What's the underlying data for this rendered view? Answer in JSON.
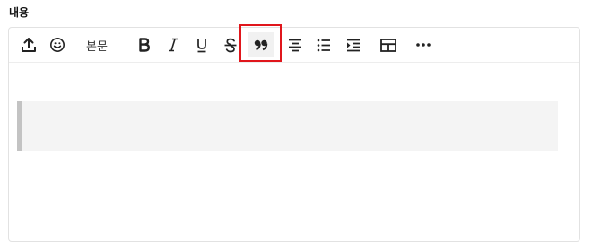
{
  "field": {
    "label": "내용"
  },
  "toolbar": {
    "style_dropdown": "본문",
    "buttons": [
      {
        "name": "upload",
        "icon": "upload-icon"
      },
      {
        "name": "emoji",
        "icon": "smiley-icon"
      },
      {
        "name": "bold",
        "icon": "bold-icon"
      },
      {
        "name": "italic",
        "icon": "italic-icon"
      },
      {
        "name": "underline",
        "icon": "underline-icon"
      },
      {
        "name": "strikethrough",
        "icon": "strikethrough-icon"
      },
      {
        "name": "quote",
        "icon": "quote-icon",
        "active": true,
        "highlighted": true
      },
      {
        "name": "align-center",
        "icon": "align-center-icon"
      },
      {
        "name": "bulleted-list",
        "icon": "bulleted-list-icon"
      },
      {
        "name": "indent",
        "icon": "indent-icon"
      },
      {
        "name": "table",
        "icon": "table-icon"
      },
      {
        "name": "more",
        "icon": "more-icon"
      }
    ]
  },
  "editor": {
    "blockquote_text": ""
  },
  "colors": {
    "highlight": "#e0161c",
    "quote_bar": "#c3c3c3",
    "quote_bg": "#f4f4f4",
    "border": "#e2e2e2"
  }
}
